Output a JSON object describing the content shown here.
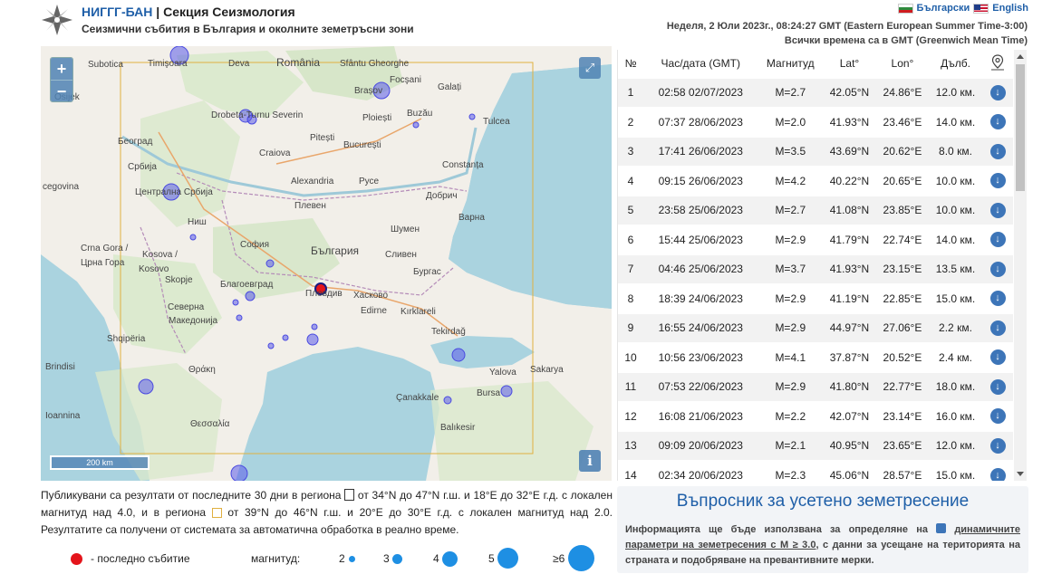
{
  "header": {
    "brand_name": "НИГГГ-БАН",
    "separator": " | ",
    "section": "Секция Сеизмология",
    "subtitle": "Сеизмични събития в България и околните земетръсни зони",
    "lang_bg": "Български",
    "lang_en": "English",
    "datetime": "Неделя, 2 Юли 2023г., 08:24:27 GMT (Eastern European Summer Time-3:00)",
    "timezone_note": "Всички времена са в GMT (Greenwich Mean Time)"
  },
  "map": {
    "zoom_in": "+",
    "zoom_out": "−",
    "scale_label": "200 km",
    "info": "i",
    "labels": [
      {
        "text": "Timişoara"
      },
      {
        "text": "Deva"
      },
      {
        "text": "România"
      },
      {
        "text": "Sfântu Gheorghe"
      },
      {
        "text": "Focşani"
      },
      {
        "text": "Galați"
      },
      {
        "text": "Brașov"
      },
      {
        "text": "Suboticа"
      },
      {
        "text": "Osijek"
      },
      {
        "text": "Drobeta-Turnu Severin"
      },
      {
        "text": "Ploiești"
      },
      {
        "text": "Buzău"
      },
      {
        "text": "Tulcea"
      },
      {
        "text": "Београд"
      },
      {
        "text": "Pitești"
      },
      {
        "text": "București"
      },
      {
        "text": "Craiova"
      },
      {
        "text": "Constanța"
      },
      {
        "text": "Србија"
      },
      {
        "text": "Alexandria"
      },
      {
        "text": "Русе"
      },
      {
        "text": "Добрич"
      },
      {
        "text": "cegovina"
      },
      {
        "text": "Централна Србија"
      },
      {
        "text": "Плевен"
      },
      {
        "text": "Варна"
      },
      {
        "text": "Ниш"
      },
      {
        "text": "Шумен"
      },
      {
        "text": "София"
      },
      {
        "text": "България"
      },
      {
        "text": "Crna Gora /"
      },
      {
        "text": "Црна Гора"
      },
      {
        "text": "Kosova /"
      },
      {
        "text": "Kosovo"
      },
      {
        "text": "Сливен"
      },
      {
        "text": "Бургас"
      },
      {
        "text": "Благоевград"
      },
      {
        "text": "Пловдив"
      },
      {
        "text": "Skopje"
      },
      {
        "text": "Хасково"
      },
      {
        "text": "Северна"
      },
      {
        "text": "Македонија"
      },
      {
        "text": "Edirne"
      },
      {
        "text": "Kırklareli"
      },
      {
        "text": "Shqipëria"
      },
      {
        "text": "Tekirdağ"
      },
      {
        "text": "Brindisi"
      },
      {
        "text": "Yalova"
      },
      {
        "text": "Sakarya"
      },
      {
        "text": "Bursa"
      },
      {
        "text": "Çanakkale"
      },
      {
        "text": "Balıkesir"
      },
      {
        "text": "Ioannina"
      },
      {
        "text": "Θράκη"
      },
      {
        "text": "Θεσσαλία"
      }
    ]
  },
  "table": {
    "headers": [
      "№",
      "Час/дата (GMT)",
      "Магнитуд",
      "Lat°",
      "Lon°",
      "Дълб."
    ],
    "rows": [
      {
        "n": "1",
        "time": "02:58 02/07/2023",
        "mag": "M=2.7",
        "lat": "42.05°N",
        "lon": "24.86°E",
        "depth": "12.0 км."
      },
      {
        "n": "2",
        "time": "07:37 28/06/2023",
        "mag": "M=2.0",
        "lat": "41.93°N",
        "lon": "23.46°E",
        "depth": "14.0 км."
      },
      {
        "n": "3",
        "time": "17:41 26/06/2023",
        "mag": "M=3.5",
        "lat": "43.69°N",
        "lon": "20.62°E",
        "depth": "8.0 км."
      },
      {
        "n": "4",
        "time": "09:15 26/06/2023",
        "mag": "M=4.2",
        "lat": "40.22°N",
        "lon": "20.65°E",
        "depth": "10.0 км."
      },
      {
        "n": "5",
        "time": "23:58 25/06/2023",
        "mag": "M=2.7",
        "lat": "41.08°N",
        "lon": "23.85°E",
        "depth": "10.0 км."
      },
      {
        "n": "6",
        "time": "15:44 25/06/2023",
        "mag": "M=2.9",
        "lat": "41.79°N",
        "lon": "22.74°E",
        "depth": "14.0 км."
      },
      {
        "n": "7",
        "time": "04:46 25/06/2023",
        "mag": "M=3.7",
        "lat": "41.93°N",
        "lon": "23.15°E",
        "depth": "13.5 км."
      },
      {
        "n": "8",
        "time": "18:39 24/06/2023",
        "mag": "M=2.9",
        "lat": "41.19°N",
        "lon": "22.85°E",
        "depth": "15.0 км."
      },
      {
        "n": "9",
        "time": "16:55 24/06/2023",
        "mag": "M=2.9",
        "lat": "44.97°N",
        "lon": "27.06°E",
        "depth": "2.2 км."
      },
      {
        "n": "10",
        "time": "10:56 23/06/2023",
        "mag": "M=4.1",
        "lat": "37.87°N",
        "lon": "20.52°E",
        "depth": "2.4 км."
      },
      {
        "n": "11",
        "time": "07:53 22/06/2023",
        "mag": "M=2.9",
        "lat": "41.80°N",
        "lon": "22.77°E",
        "depth": "18.0 км."
      },
      {
        "n": "12",
        "time": "16:08 21/06/2023",
        "mag": "M=2.2",
        "lat": "42.07°N",
        "lon": "23.14°E",
        "depth": "16.0 км."
      },
      {
        "n": "13",
        "time": "09:09 20/06/2023",
        "mag": "M=2.1",
        "lat": "40.95°N",
        "lon": "23.65°E",
        "depth": "12.0 км."
      },
      {
        "n": "14",
        "time": "02:34 20/06/2023",
        "mag": "M=2.3",
        "lat": "45.06°N",
        "lon": "28.57°E",
        "depth": "15.0 км."
      }
    ]
  },
  "description": {
    "part1": "Публикувани са резултати от последните 30 дни в региона",
    "part2": "от 34°N до 47°N г.ш. и 18°E до 32°E г.д. с локален магнитуд над 4.0, и в региона",
    "part3": "от 39°N до 46°N г.ш. и 20°E до 30°E г.д. с локален магнитуд над 2.0. Резултатите са получени от системата за автоматична обработка в реално време."
  },
  "legend": {
    "last_event": "- последно събитие",
    "magnitude_label": "магнитуд:",
    "sizes": [
      "2",
      "3",
      "4",
      "5",
      "≥6"
    ]
  },
  "questionnaire": {
    "title": "Въпросник за усетено земетресение",
    "text_before": "Информацията ще бъде използвана за определяне на",
    "link": "динамичните параметри на земетресения с M ≥ 3.0",
    "text_after": ", с данни за усещане на територията на страната и подобряване на превантивните мерки."
  },
  "colors": {
    "brand_blue": "#1f5fa8",
    "last_event_red": "#e4141b",
    "legend_blue": "#1e8fe3",
    "event_violet": "#5b5bea"
  }
}
